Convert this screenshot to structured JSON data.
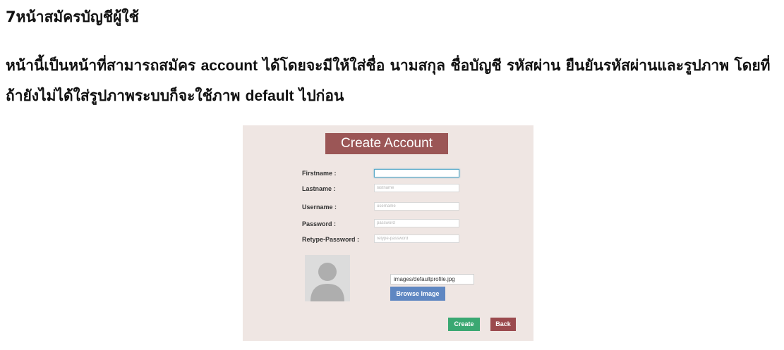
{
  "document": {
    "heading": "7หน้าสมัครบัญชีผู้ใช้",
    "paragraph": {
      "part1": "หน้านี้เป็นหน้าที่สามารถสมัคร ",
      "term1": "account",
      "part2": " ได้โดยจะมีให้ใส่ชื่อ นามสกุล ชื่อบัญชี รหัสผ่าน ยืนยันรหัสผ่านและรูปภาพ โดยที่ถ้ายังไม่ได้ใส่รูปภาพระบบก็จะใช้ภาพ ",
      "term2": "default",
      "part3": " ไปก่อน"
    }
  },
  "form": {
    "title": "Create Account",
    "fields": [
      {
        "label": "Firstname :",
        "value": "",
        "placeholder": ""
      },
      {
        "label": "Lastname :",
        "value": "",
        "placeholder": "lastname"
      },
      {
        "label": "Username :",
        "value": "",
        "placeholder": "username"
      },
      {
        "label": "Password :",
        "value": "",
        "placeholder": "password"
      },
      {
        "label": "Retype-Password :",
        "value": "",
        "placeholder": "retype-password"
      }
    ],
    "image_path": "images/defaultprofile.jpg",
    "browse_label": "Browse Image",
    "create_label": "Create",
    "back_label": "Back",
    "avatar_icon": "user-silhouette-icon"
  },
  "colors": {
    "panel_bg": "#efe6e3",
    "title_bg": "#9b5656",
    "browse_bg": "#5f87c2",
    "create_bg": "#3aa872",
    "back_bg": "#9b4a4e"
  }
}
